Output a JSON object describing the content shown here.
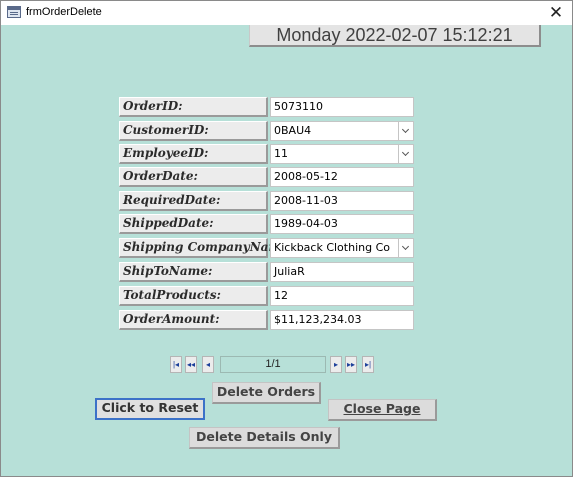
{
  "window": {
    "title": "frmOrderDelete",
    "close_glyph": "✕"
  },
  "datetime": "Monday 2022-02-07 15:12:21",
  "fields": {
    "order_id": {
      "label": "OrderID:",
      "value": "5073110"
    },
    "customer_id": {
      "label": "CustomerID:",
      "value": "0BAU4"
    },
    "employee_id": {
      "label": "EmployeeID:",
      "value": "11"
    },
    "order_date": {
      "label": "OrderDate:",
      "value": "2008-05-12"
    },
    "required_date": {
      "label": "RequiredDate:",
      "value": "2008-11-03"
    },
    "shipped_date": {
      "label": "ShippedDate:",
      "value": "1989-04-03"
    },
    "shipping_company": {
      "label": "Shipping CompanyName:",
      "value": "Kickback Clothing Co"
    },
    "ship_to_name": {
      "label": "ShipToName:",
      "value": "JuliaR"
    },
    "total_products": {
      "label": "TotalProducts:",
      "value": "12"
    },
    "order_amount": {
      "label": "OrderAmount:",
      "value": "$11,123,234.03"
    }
  },
  "navigation": {
    "first": "|◂",
    "prev_page": "◂◂",
    "prev": "◂",
    "record_counter": "1/1",
    "next": "▸",
    "next_page": "▸▸",
    "last": "▸|"
  },
  "buttons": {
    "delete_orders": "Delete  Orders",
    "click_to_reset": "Click to Reset",
    "close_page": "Close Page",
    "delete_details_only": "Delete Details Only"
  },
  "colors": {
    "form_background": "#b7e0d8",
    "focus_border": "#3c72c8",
    "nav_arrow": "#1c3f9a"
  },
  "icons": [
    "form-window-icon",
    "close-icon",
    "combo-dropdown-icon"
  ]
}
